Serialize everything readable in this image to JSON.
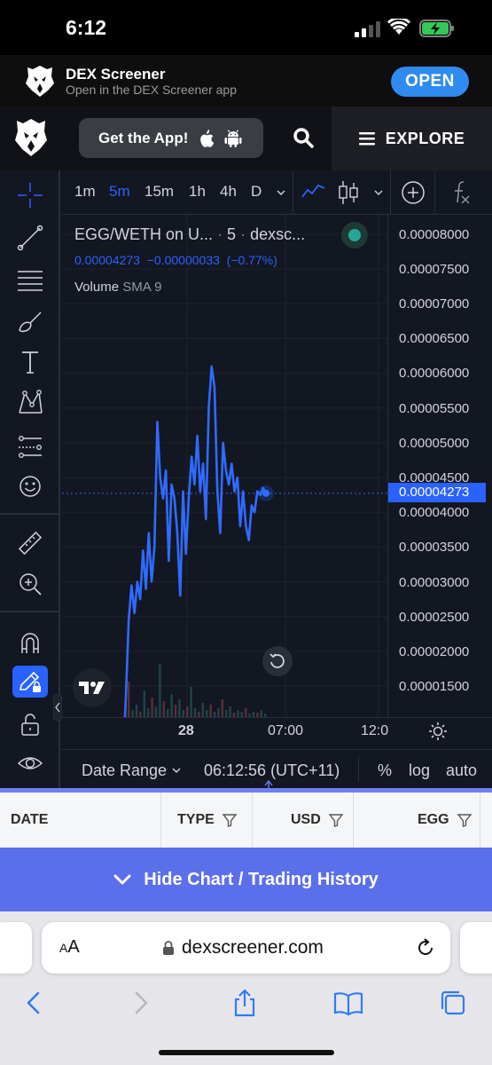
{
  "status_bar": {
    "time": "6:12"
  },
  "app_banner": {
    "title": "DEX Screener",
    "subtitle": "Open in the DEX Screener app",
    "open_label": "OPEN"
  },
  "header": {
    "get_app_label": "Get the App!",
    "explore_label": "EXPLORE"
  },
  "chart": {
    "timeframes": [
      "1m",
      "5m",
      "15m",
      "1h",
      "4h",
      "D"
    ],
    "active_timeframe": "5m",
    "legend": {
      "symbol": "EGG/WETH on U...",
      "interval": "5",
      "source": "dexsc...",
      "price": "0.00004273",
      "change": "−0.00000033",
      "change_pct": "(−0.77%)",
      "volume_label": "Volume",
      "volume_indicator": "SMA 9"
    },
    "price_axis": [
      "0.00008000",
      "0.00007500",
      "0.00007000",
      "0.00006500",
      "0.00006000",
      "0.00005500",
      "0.00005000",
      "0.00004500",
      "0.00004000",
      "0.00003500",
      "0.00003000",
      "0.00002500",
      "0.00002000",
      "0.00001500"
    ],
    "current_price": "0.00004273",
    "time_axis": [
      "28",
      "07:00",
      "12:0"
    ],
    "bottom_bar": {
      "date_range": "Date Range",
      "clock": "06:12:56 (UTC+11)",
      "percent": "%",
      "log": "log",
      "auto": "auto"
    },
    "colors": {
      "line": "#2f6bff",
      "background": "#131722",
      "accent": "#2962ff"
    }
  },
  "chart_data": {
    "type": "line",
    "title": "EGG/WETH",
    "ylim": [
      1.2e-05,
      8.2e-05
    ],
    "series": [
      {
        "name": "EGG/WETH",
        "values": [
          1.35e-05,
          2.45e-05,
          2.95e-05,
          2.55e-05,
          3e-05,
          2.75e-05,
          3.45e-05,
          2.9e-05,
          3.7e-05,
          3e-05,
          3.5e-05,
          5.3e-05,
          4.5e-05,
          4.2e-05,
          4.6e-05,
          3.3e-05,
          4.4e-05,
          4.2e-05,
          3.7e-05,
          2.8e-05,
          4.3e-05,
          3.4e-05,
          4.2e-05,
          4.8e-05,
          4.4e-05,
          5.1e-05,
          4.3e-05,
          4.7e-05,
          3.9e-05,
          5.5e-05,
          6.1e-05,
          5.8e-05,
          4.3e-05,
          3.7e-05,
          5e-05,
          4.6e-05,
          4.4e-05,
          4.7e-05,
          4.3e-05,
          4.5e-05,
          3.8e-05,
          4.3e-05,
          3.8e-05,
          3.6e-05,
          4.1e-05,
          4e-05,
          4.3e-05,
          4.25e-05,
          4.35e-05,
          4.273e-05
        ]
      }
    ]
  },
  "table": {
    "columns": [
      "DATE",
      "TYPE",
      "USD",
      "EGG"
    ]
  },
  "hide_bar": {
    "label": "Hide Chart / Trading History"
  },
  "safari": {
    "aa_label": "AA",
    "url": "dexscreener.com"
  }
}
